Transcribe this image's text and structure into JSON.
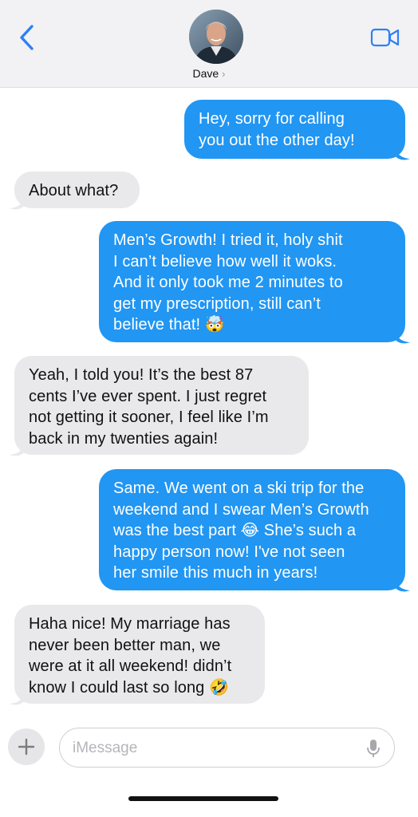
{
  "header": {
    "contact_name": "Dave",
    "chevron": "›",
    "back_icon": "chevron-left-icon",
    "video_icon": "video-camera-icon",
    "accent_color": "#2f7ff6"
  },
  "messages": [
    {
      "from": "me",
      "lines": [
        "Hey, sorry for calling",
        "you out the other day!"
      ]
    },
    {
      "from": "them",
      "lines": [
        "About what?"
      ]
    },
    {
      "from": "me",
      "lines": [
        "Men’s Growth! I tried it, holy shit",
        "I can’t believe how well it woks.",
        "And it only took me 2 minutes to",
        "get my prescription, still can’t",
        "believe that! 🤯"
      ]
    },
    {
      "from": "them",
      "lines": [
        "Yeah, I told you! It’s the best 87",
        "cents I’ve ever spent. I just regret",
        "not getting it sooner, I feel like I’m",
        "back in my twenties again!"
      ]
    },
    {
      "from": "me",
      "lines": [
        "Same. We went on a ski trip for the",
        "weekend and I swear Men’s Growth",
        "was the best part 😂  She’s such a",
        "happy person now! I've not seen",
        "her smile this much in years!"
      ]
    },
    {
      "from": "them",
      "lines": [
        "Haha nice! My marriage has",
        "never been better man, we",
        "were at it all weekend! didn’t",
        "know I could last so long 🤣"
      ]
    }
  ],
  "colors": {
    "sent_bubble": "#2196f3",
    "received_bubble": "#e9e9eb"
  },
  "composer": {
    "placeholder": "iMessage",
    "plus_label": "+",
    "mic_icon": "microphone-icon"
  }
}
